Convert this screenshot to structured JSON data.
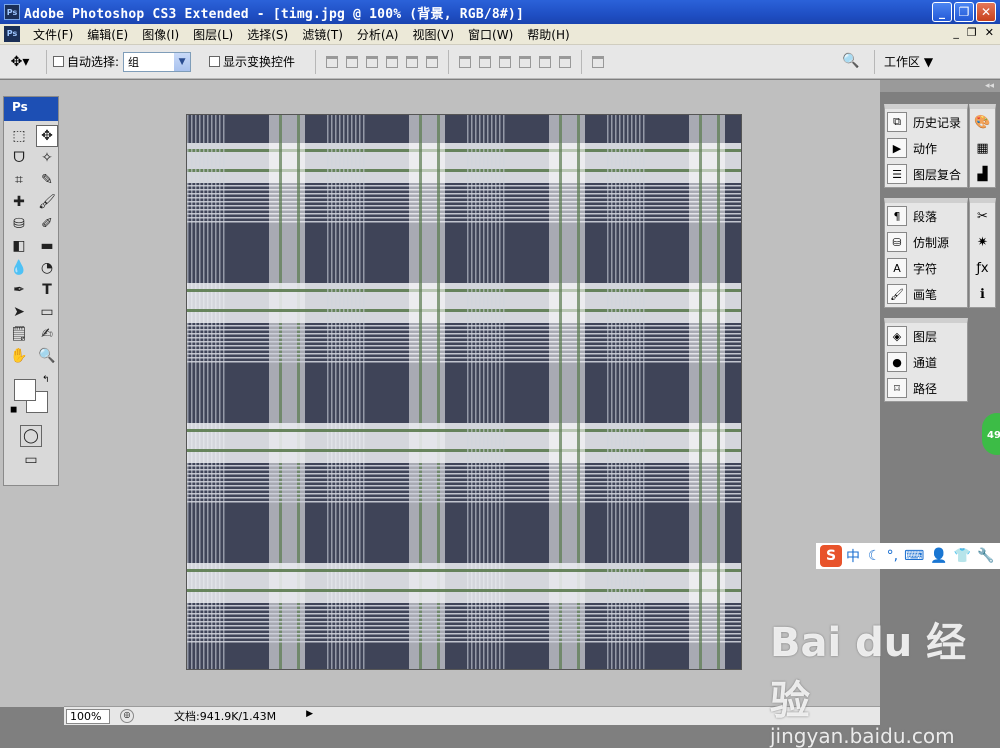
{
  "title_bar": {
    "app_icon": "Ps",
    "title": "Adobe Photoshop CS3 Extended - [timg.jpg @ 100% (背景, RGB/8#)]"
  },
  "menu": [
    "文件(F)",
    "编辑(E)",
    "图像(I)",
    "图层(L)",
    "选择(S)",
    "滤镜(T)",
    "分析(A)",
    "视图(V)",
    "窗口(W)",
    "帮助(H)"
  ],
  "options_bar": {
    "auto_select_label": "自动选择:",
    "auto_select_value": "组",
    "show_transform_label": "显示变换控件",
    "workspace_label": "工作区 ▼"
  },
  "toolbox": {
    "header": "Ps"
  },
  "panels": {
    "group1": [
      "历史记录",
      "动作",
      "图层复合"
    ],
    "group2": [
      "段落",
      "仿制源",
      "字符",
      "画笔"
    ],
    "group3": [
      "图层",
      "通道",
      "路径"
    ]
  },
  "status": {
    "zoom": "100%",
    "doc_info": "文档:941.9K/1.43M"
  },
  "ime": {
    "label": "中"
  },
  "float_badge": "49",
  "watermark": {
    "brand": "Bai du 经验",
    "url": "jingyan.baidu.com"
  },
  "colors": {
    "title_blue": "#1f4fc4",
    "plaid_dark": "#3f4458",
    "plaid_stripe": "#5a7a4e"
  }
}
